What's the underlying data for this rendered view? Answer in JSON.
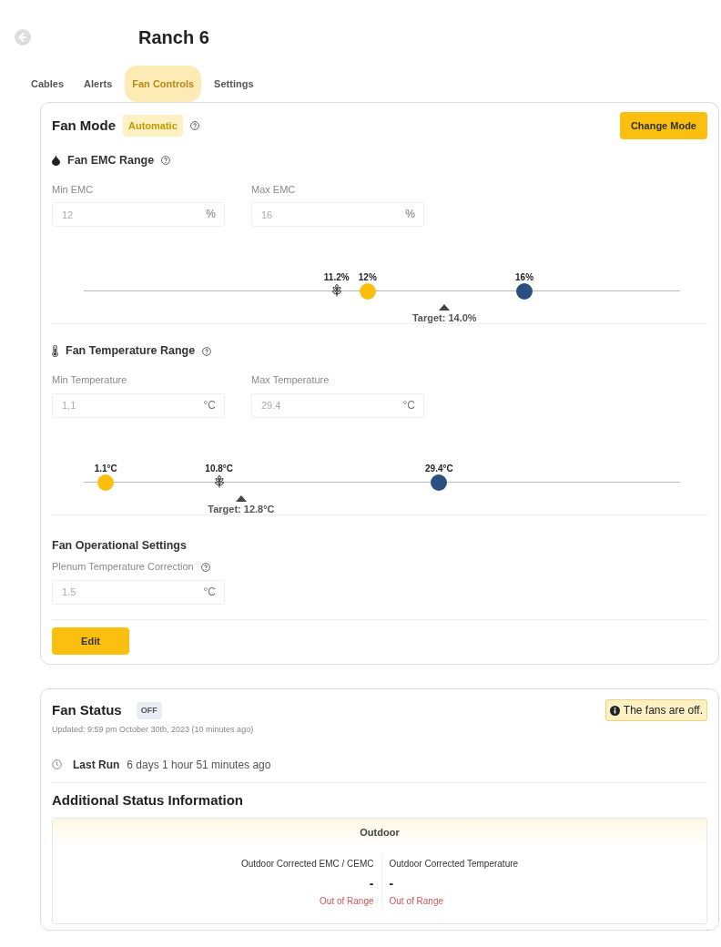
{
  "header": {
    "title": "Ranch 6"
  },
  "tabs": [
    {
      "label": "Cables",
      "selected": false
    },
    {
      "label": "Alerts",
      "selected": false
    },
    {
      "label": "Fan Controls",
      "selected": true
    },
    {
      "label": "Settings",
      "selected": false
    }
  ],
  "fan_mode": {
    "title": "Fan Mode",
    "mode_badge": "Automatic",
    "change_button": "Change Mode",
    "ranges": [
      {
        "kind": "emc",
        "title": "Fan EMC Range",
        "fields": [
          {
            "label": "Min EMC",
            "value": "12",
            "unit": "%",
            "disabled": true
          },
          {
            "label": "Max EMC",
            "value": "16",
            "unit": "%",
            "disabled": true
          }
        ],
        "markers": [
          {
            "kind": "grain",
            "label": "11.2%",
            "level": 0.424
          },
          {
            "kind": "min",
            "label": "12%",
            "level": 0.476
          },
          {
            "kind": "max",
            "label": "16%",
            "level": 0.739
          },
          {
            "kind": "target",
            "label": "Target: 14.0%",
            "level": 0.605
          }
        ]
      },
      {
        "kind": "temperature",
        "title": "Fan Temperature Range",
        "fields": [
          {
            "label": "Min Temperature",
            "value": "1.1",
            "unit": "°C",
            "disabled": true
          },
          {
            "label": "Max Temperature",
            "value": "29.4",
            "unit": "°C",
            "disabled": true
          }
        ],
        "markers": [
          {
            "kind": "min",
            "label": "1.1°C",
            "level": 0.037
          },
          {
            "kind": "grain",
            "label": "10.8°C",
            "level": 0.227
          },
          {
            "kind": "max",
            "label": "29.4°C",
            "level": 0.596
          },
          {
            "kind": "target",
            "label": "Target: 12.8°C",
            "level": 0.264
          }
        ]
      }
    ],
    "operational": {
      "title": "Fan Operational Settings",
      "field": {
        "label": "Plenum Temperature Correction",
        "value": "1.5",
        "unit": "°C",
        "disabled": true
      }
    },
    "edit_button": "Edit"
  },
  "fan_status": {
    "title": "Fan Status",
    "badge": "OFF",
    "alert": "The fans are off.",
    "updated": "Updated: 9:59 pm October 30th, 2023 (10 minutes ago)",
    "last_run_label": "Last Run",
    "last_run_value": "6 days 1 hour 51 minutes ago",
    "additional_title": "Additional Status Information",
    "panel": {
      "title": "Outdoor",
      "readings": [
        {
          "label": "Outdoor Corrected EMC / CEMC",
          "value": "-",
          "status": "Out of Range"
        },
        {
          "label": "Outdoor Corrected Temperature",
          "value": "-",
          "status": "Out of Range"
        }
      ]
    }
  }
}
